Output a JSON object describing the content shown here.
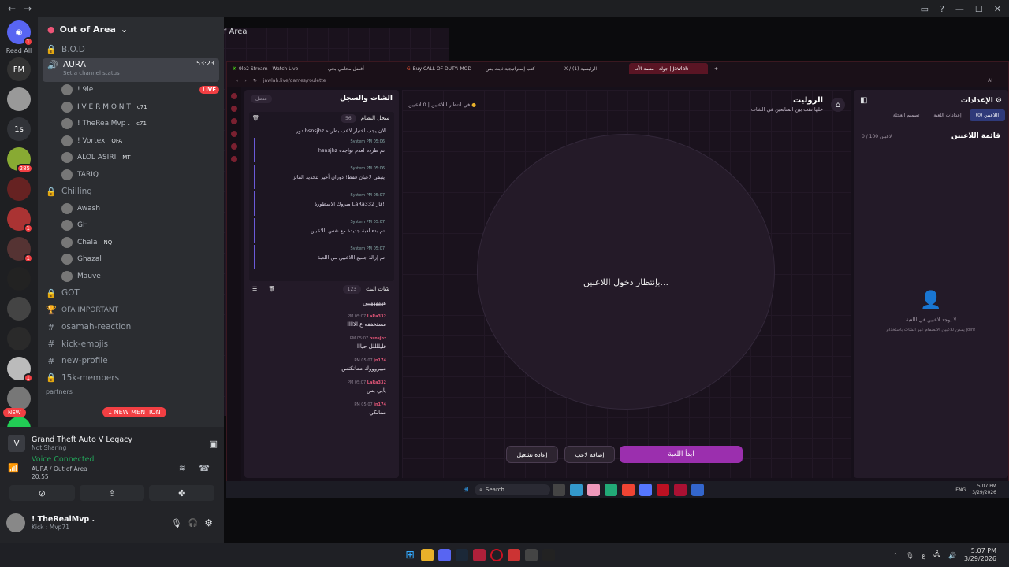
{
  "window": {
    "title": "Out of Area",
    "nav_back": "←",
    "nav_fwd": "→"
  },
  "rail": {
    "read_all": "Read All",
    "new_label": "NEW",
    "badges": [
      "1",
      "1",
      "285",
      "1",
      "1",
      "1",
      "1"
    ],
    "letters": "1s"
  },
  "server": {
    "name": "Out of Area"
  },
  "channels": {
    "bod": "B.O.D",
    "aura": "AURA",
    "aura_time": "53:23",
    "aura_status": "Set a channel status",
    "voice_users": [
      {
        "name": "! 9le",
        "tag": ""
      },
      {
        "name": "I V E R M O N T",
        "tag": "c71"
      },
      {
        "name": "! TheRealMvp .",
        "tag": "c71"
      },
      {
        "name": "! Vortex",
        "tag": "OFA"
      },
      {
        "name": "ALOL ASIRI",
        "tag": "MT"
      },
      {
        "name": "TARIQ",
        "tag": ""
      }
    ],
    "live": "LIVE",
    "chilling": "Chilling",
    "chill_users": [
      {
        "name": "Awash",
        "tag": ""
      },
      {
        "name": "GH",
        "tag": ""
      },
      {
        "name": "Chala",
        "tag": "NQ"
      },
      {
        "name": "Ghazal",
        "tag": ""
      },
      {
        "name": "Mauve",
        "tag": ""
      }
    ],
    "got": "GOT",
    "important": "OFA IMPORTANT",
    "text": [
      "osamah-reaction",
      "kick-emojis",
      "new-profile",
      "15k-members"
    ],
    "partners": "partners",
    "new_mention": "1 NEW MENTION"
  },
  "panel": {
    "game": "Grand Theft Auto V Legacy",
    "sharing": "Not Sharing",
    "voice_connected": "Voice Connected",
    "voice_sub": "AURA / Out of Area",
    "voice_time": "20:55",
    "user": "! TheRealMvp .",
    "user_status": "Kick : Mvp71"
  },
  "browser": {
    "tabs": [
      "9le2 Stream - Watch Live",
      "أفضل محامي بحي",
      "Buy CALL OF DUTY: MOD",
      "كتب إستراتيجية ثابت بس",
      "X / الرئيسية (1)",
      "جولة - منصة الأتـ | Jawlah"
    ],
    "url": "jawlah.live/games/roulette",
    "ai": "AI"
  },
  "chatpanel": {
    "title": "الشات والسجل",
    "connected": "متصل",
    "syslog": "سجل النظام",
    "syslog_count": "56",
    "top_msg": "دور hsnsjhz الان يجب اختيار لاعب بطرده",
    "messages": [
      {
        "meta": "System  PM 05:06",
        "text": "hsnsjhz تم طرده لعدم تواجده"
      },
      {
        "meta": "System  PM 05:06",
        "text": "يتبقى لاعبان فقط! دوران أخير لتحديد الفائز"
      },
      {
        "meta": "System  PM 05:07",
        "text": "مبروك الاسطورة LaRa332 فاز!"
      },
      {
        "meta": "System  PM 05:07",
        "text": "تم بدء لعبة جديدة مع نفس اللاعبين"
      },
      {
        "meta": "System  PM 05:07",
        "text": "تم إزالة جميع اللاعبين من اللعبة"
      }
    ],
    "livechat": "شات البث",
    "livechat_count": "123",
    "chat_top": "ههههههييي",
    "chat": [
      {
        "user": "LaRa332",
        "time": "PM 05:07",
        "text": "مستخففه ع الااااا"
      },
      {
        "user": "hsnsjhz",
        "time": "PM 05:07",
        "text": "فليللللل حيااا"
      },
      {
        "user": "jn174",
        "time": "PM 05:07",
        "text": "مبيروووك ممانكنس"
      },
      {
        "user": "LaRa332",
        "time": "PM 05:07",
        "text": "يابي بس"
      },
      {
        "user": "jn174",
        "time": "PM 05:07",
        "text": "ممانكي"
      }
    ]
  },
  "game": {
    "title": "الروليت",
    "subtitle": "خلها تقب بين المتابعين في الشات",
    "players_count": "0 لاعبين",
    "waiting_status": "في انتظار اللاعبين",
    "waiting": "بإنتظار دخول اللاعبين...",
    "btn_start": "ابدأ اللعبة",
    "btn_add": "إضافة لاعب",
    "btn_restart": "إعادة تشغيل"
  },
  "settings": {
    "title": "الإعدادات",
    "tabs": [
      "اللاعبين (0)",
      "إعدادات اللعبة",
      "تصميم العجلة"
    ],
    "list_title": "قائمة اللاعبين",
    "list_count": "0 / 100 لاعبين",
    "empty": "لا يوجد لاعبين في اللعبة",
    "empty_hint": "يمكن للاعبين الانضمام عبر الشات باستخدام join!"
  },
  "taskbar": {
    "search": "Search",
    "lang": "ENG",
    "time": "5:07 PM",
    "date": "3/29/2026",
    "lang2": "ع"
  },
  "colors": {
    "accent": "#9b2fae",
    "brand": "#5865f2",
    "live": "#f23f43"
  }
}
